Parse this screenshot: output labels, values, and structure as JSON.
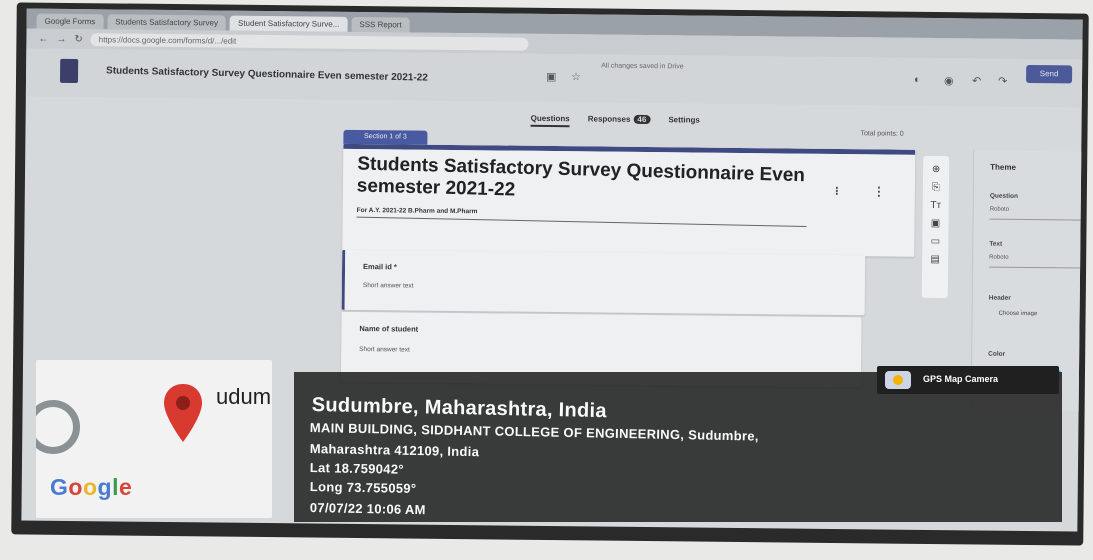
{
  "browser": {
    "tabs": [
      {
        "label": "Google Forms"
      },
      {
        "label": "Students Satisfactory Survey"
      },
      {
        "label": "Student Satisfactory Surve..."
      },
      {
        "label": "SSS Report"
      }
    ],
    "url": "https://docs.google.com/forms/d/.../edit"
  },
  "header": {
    "doc_title": "Students Satisfactory Survey Questionnaire Even semester 2021-22",
    "saved_message": "All changes saved in Drive",
    "send_label": "Send"
  },
  "nav_tabs": {
    "questions": "Questions",
    "responses": "Responses",
    "response_count": "46",
    "settings": "Settings",
    "total_points": "Total points: 0"
  },
  "form": {
    "section_label": "Section 1 of 3",
    "title": "Students Satisfactory Survey Questionnaire Even semester 2021-22",
    "description": "For A.Y. 2021-22 B.Pharm and M.Pharm",
    "questions": [
      {
        "label": "Email id *",
        "hint": "Short answer text"
      },
      {
        "label": "Name of student",
        "hint": "Short answer text"
      }
    ]
  },
  "theme_panel": {
    "title": "Theme",
    "header_label": "Question",
    "header_value": "Roboto",
    "text_label": "Text",
    "text_value": "Roboto",
    "image_label": "Header",
    "choose_image": "Choose image",
    "color_label": "Color",
    "swatch_colors": [
      "#c0392b",
      "#3f4a82",
      "#2e6da4",
      "#1f7a8c",
      "#4a9bd6"
    ]
  },
  "gps": {
    "camera_label": "GPS Map Camera",
    "map_place": "udumb",
    "map_brand": "Google",
    "title": "Sudumbre, Maharashtra, India",
    "address_line1": "MAIN BUILDING, SIDDHANT COLLEGE OF ENGINEERING, Sudumbre,",
    "address_line2": "Maharashtra 412109, India",
    "lat": "Lat 18.759042°",
    "long": "Long 73.755059°",
    "timestamp": "07/07/22 10:06 AM"
  }
}
